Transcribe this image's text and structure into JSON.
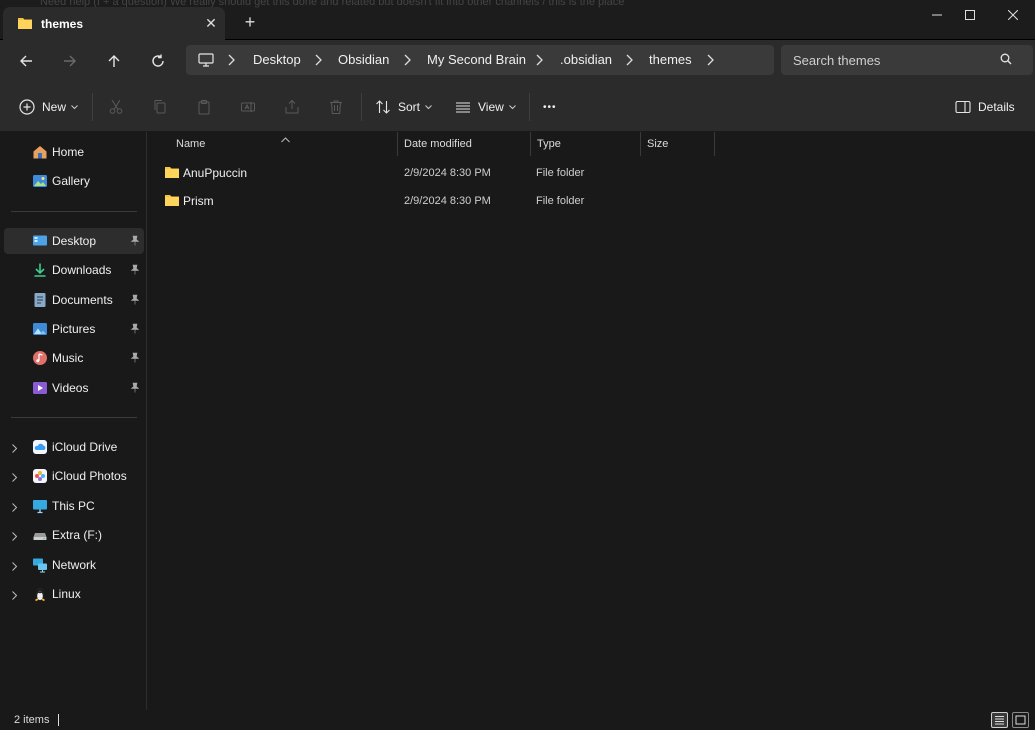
{
  "window": {
    "background_text": "Need help (I + a question) We really should get this done and related but doesn't fit into other channels / this is the place",
    "tab_title": "themes",
    "tab_close_label": "✕",
    "new_tab_label": "+"
  },
  "address": {
    "crumbs": [
      "Desktop",
      "Obsidian",
      "My Second Brain",
      ".obsidian",
      "themes"
    ],
    "search_placeholder": "Search themes"
  },
  "toolbar": {
    "new_label": "New",
    "sort_label": "Sort",
    "view_label": "View",
    "more_label": "•••",
    "details_label": "Details"
  },
  "sidebar": {
    "top": [
      {
        "label": "Home",
        "icon": "home-icon"
      },
      {
        "label": "Gallery",
        "icon": "gallery-icon"
      }
    ],
    "quick": [
      {
        "label": "Desktop",
        "icon": "desktop-icon",
        "pinned": true,
        "active": true
      },
      {
        "label": "Downloads",
        "icon": "downloads-icon",
        "pinned": true
      },
      {
        "label": "Documents",
        "icon": "documents-icon",
        "pinned": true
      },
      {
        "label": "Pictures",
        "icon": "pictures-icon",
        "pinned": true
      },
      {
        "label": "Music",
        "icon": "music-icon",
        "pinned": true
      },
      {
        "label": "Videos",
        "icon": "videos-icon",
        "pinned": true
      }
    ],
    "drives": [
      {
        "label": "iCloud Drive",
        "icon": "icloud-drive-icon"
      },
      {
        "label": "iCloud Photos",
        "icon": "icloud-photos-icon"
      },
      {
        "label": "This PC",
        "icon": "this-pc-icon"
      },
      {
        "label": "Extra (F:)",
        "icon": "drive-icon"
      },
      {
        "label": "Network",
        "icon": "network-icon"
      },
      {
        "label": "Linux",
        "icon": "linux-icon"
      }
    ]
  },
  "columns": {
    "name": "Name",
    "date": "Date modified",
    "type": "Type",
    "size": "Size"
  },
  "files": [
    {
      "name": "AnuPpuccin",
      "date": "2/9/2024 8:30 PM",
      "type": "File folder"
    },
    {
      "name": "Prism",
      "date": "2/9/2024 8:30 PM",
      "type": "File folder"
    }
  ],
  "status": {
    "count": "2 items"
  },
  "colors": {
    "background": "#191919",
    "toolbar": "#2b2b2b",
    "folder": "#f5c342",
    "accent": "#4cc2ff"
  }
}
